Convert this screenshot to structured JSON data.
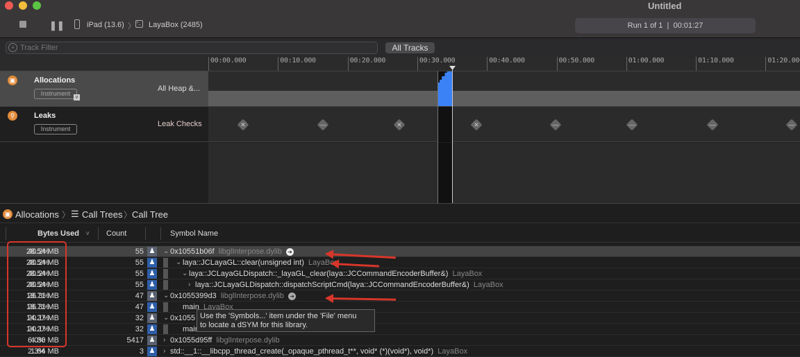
{
  "window": {
    "title": "Untitled",
    "device": "iPad (13.6)",
    "process": "LayaBox (2485)",
    "run_status": "Run 1 of 1  |  00:01:27"
  },
  "filter": {
    "placeholder": "Track Filter",
    "all_tracks_label": "All Tracks"
  },
  "ruler": {
    "ticks": [
      "00:00.000",
      "00:10.000",
      "00:20.000",
      "00:30.000",
      "00:40.000",
      "00:50.000",
      "01:00.000",
      "01:10.000",
      "01:20.000"
    ]
  },
  "tracks": [
    {
      "name": "Allocations",
      "badge": "Instrument",
      "detail": "All Heap &..."
    },
    {
      "name": "Leaks",
      "badge": "Instrument",
      "detail": "Leak Checks",
      "markers": [
        "x",
        "-",
        "x",
        "x",
        "-",
        "-",
        "-",
        "-"
      ]
    }
  ],
  "breadcrumb": [
    "Allocations",
    "Call Trees",
    "Call Tree"
  ],
  "table": {
    "columns": {
      "bytes": "Bytes Used",
      "count": "Count",
      "symbol": "Symbol Name"
    },
    "rows": [
      {
        "bytes": "28.54 MB",
        "pct": "40.2%",
        "count": "55",
        "disc": "v",
        "symbol": "0x10551b06f",
        "lib": "libglInterpose.dylib",
        "indent": 0,
        "user": false
      },
      {
        "bytes": "28.54 MB",
        "pct": "40.2%",
        "count": "55",
        "disc": "v",
        "symbol": "laya::JCLayaGL::clear(unsigned int)",
        "lib": "LayaBox",
        "indent": 1,
        "user": true
      },
      {
        "bytes": "28.54 MB",
        "pct": "40.2%",
        "count": "55",
        "disc": "v",
        "symbol": "laya::JCLayaGLDispatch::_layaGL_clear(laya::JCCommandEncoderBuffer&)",
        "lib": "LayaBox",
        "indent": 2,
        "user": true
      },
      {
        "bytes": "28.54 MB",
        "pct": "40.2%",
        "count": "55",
        "disc": ">",
        "symbol": "laya::JCLayaGLDispatch::dispatchScriptCmd(laya::JCCommandEncoderBuffer&)",
        "lib": "LayaBox",
        "indent": 3,
        "user": true
      },
      {
        "bytes": "18.71 MB",
        "pct": "26.3%",
        "count": "47",
        "disc": "v",
        "symbol": "0x1055399d3",
        "lib": "libglInterpose.dylib",
        "indent": 0,
        "user": false
      },
      {
        "bytes": "18.71 MB",
        "pct": "26.3%",
        "count": "47",
        "disc": "",
        "symbol": "main",
        "lib": "LayaBox",
        "indent": 1,
        "user": true
      },
      {
        "bytes": "14.27 MB",
        "pct": "20.1%",
        "count": "32",
        "disc": "v",
        "symbol": "0x1055",
        "lib": "",
        "indent": 0,
        "user": false
      },
      {
        "bytes": "14.27 MB",
        "pct": "20.1%",
        "count": "32",
        "disc": "",
        "symbol": "main",
        "lib": "",
        "indent": 1,
        "user": true
      },
      {
        "bytes": "4.30 MB",
        "pct": "6.0%",
        "count": "5417",
        "disc": ">",
        "symbol": "0x1055d95ff",
        "lib": "libglInterpose.dylib",
        "indent": 0,
        "user": false
      },
      {
        "bytes": "1.64 MB",
        "pct": "2.3%",
        "count": "3",
        "disc": ">",
        "symbol": "std::__1::__libcpp_thread_create(_opaque_pthread_t**, void* (*)(void*), void*)",
        "lib": "LayaBox",
        "indent": 0,
        "user": true
      }
    ]
  },
  "tooltip": {
    "line1": "Use the 'Symbols...' item under the 'File' menu",
    "line2": "to locate a dSYM for this library."
  },
  "colors": {
    "accent": "#3b82f6",
    "annotation": "#d8362a",
    "instrument": "#e08a3a"
  }
}
